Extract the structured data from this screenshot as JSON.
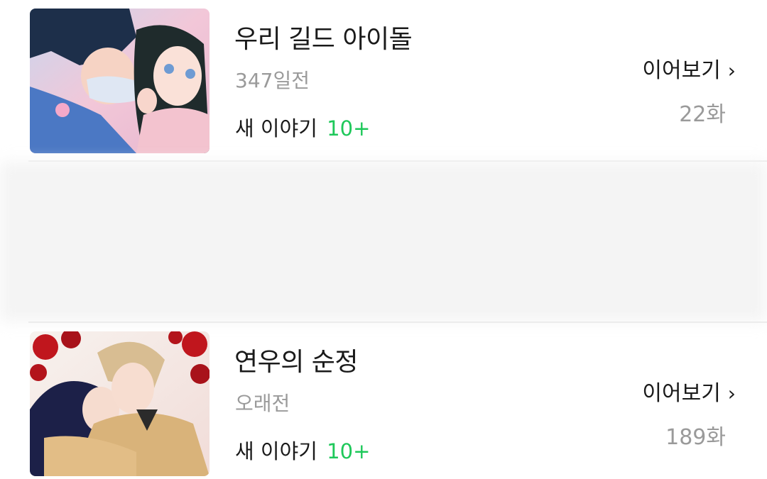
{
  "items": [
    {
      "title": "우리 길드 아이돌",
      "time": "347일전",
      "new_story_label": "새 이야기",
      "new_story_count": "10+",
      "continue_label": "이어보기",
      "episode": "22화"
    },
    {
      "title": "연우의 순정",
      "time": "오래전",
      "new_story_label": "새 이야기",
      "new_story_count": "10+",
      "continue_label": "이어보기",
      "episode": "189화"
    }
  ],
  "icons": {
    "chevron": "chevron-right-icon"
  },
  "colors": {
    "accent_green": "#1ec85a",
    "muted_gray": "#9a9a9a",
    "text_dark": "#1a1a1a"
  }
}
